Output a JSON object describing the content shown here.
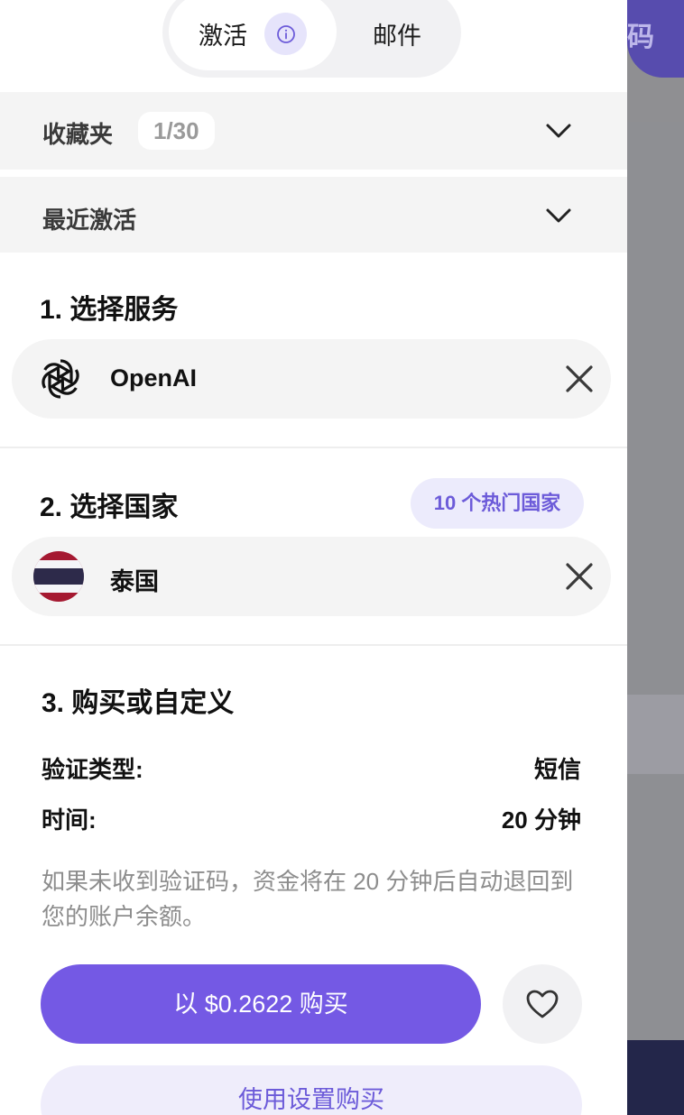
{
  "background": {
    "header_button_label": "码"
  },
  "tabs": {
    "activation_label": "激活",
    "mail_label": "邮件"
  },
  "favorites": {
    "title": "收藏夹",
    "count": "1/30"
  },
  "recent": {
    "title": "最近激活"
  },
  "step1": {
    "title": "1. 选择服务",
    "selected_service": "OpenAI",
    "service_icon": "openai-icon"
  },
  "step2": {
    "title": "2. 选择国家",
    "popular_button": "10 个热门国家",
    "selected_country": "泰国",
    "country_icon": "thailand-flag-icon"
  },
  "step3": {
    "title": "3. 购买或自定义",
    "verify_type_label": "验证类型:",
    "verify_type_value": "短信",
    "time_label": "时间:",
    "time_value": "20 分钟",
    "note": "如果未收到验证码，资金将在 20 分钟后自动退回到您的账户余额。",
    "buy_button": "以 $0.2622 购买",
    "settings_button": "使用设置购买"
  },
  "colors": {
    "accent": "#7459e4",
    "accent_light": "#ecebfc",
    "flag_red": "#a51931",
    "flag_blue": "#2d2a4a"
  }
}
